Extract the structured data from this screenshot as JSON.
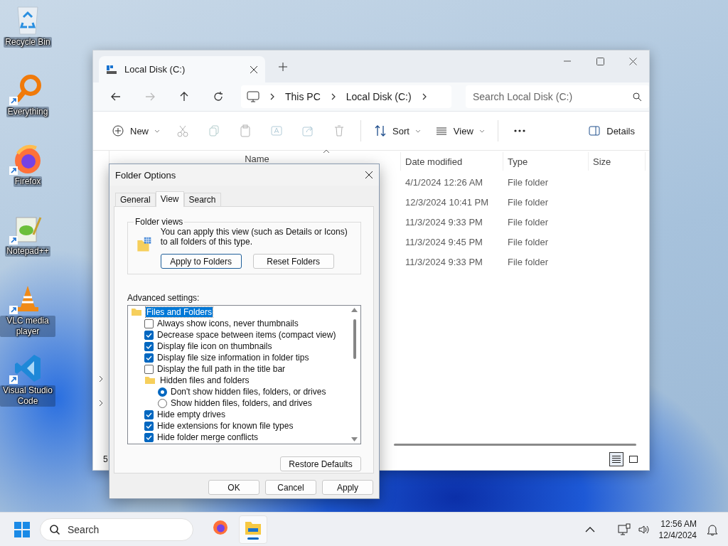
{
  "desktop_icons": [
    {
      "label": "Recycle Bin",
      "kind": "recycle",
      "shortcut": false
    },
    {
      "label": "Everything",
      "kind": "everything",
      "shortcut": true
    },
    {
      "label": "Firefox",
      "kind": "firefox",
      "shortcut": true
    },
    {
      "label": "Notepad++",
      "kind": "notepad",
      "shortcut": true
    },
    {
      "label": "VLC media player",
      "kind": "vlc",
      "shortcut": true
    },
    {
      "label": "Visual Studio Code",
      "kind": "vscode",
      "shortcut": true
    }
  ],
  "explorer": {
    "tabs": [
      {
        "label": "Local Disk (C:)",
        "selected": true
      }
    ],
    "nav": [
      {
        "kind": "back",
        "disabled": false
      },
      {
        "kind": "forward",
        "disabled": true
      },
      {
        "kind": "up",
        "disabled": false
      },
      {
        "kind": "refresh",
        "disabled": false
      }
    ],
    "breadcrumb": [
      "This PC",
      "Local Disk (C:)"
    ],
    "search": {
      "placeholder": "Search Local Disk (C:)"
    },
    "toolbar": [
      {
        "kind": "new",
        "label": "New",
        "disabled": false
      },
      {
        "kind": "cut",
        "disabled": true
      },
      {
        "kind": "copy",
        "disabled": true
      },
      {
        "kind": "paste",
        "disabled": true
      },
      {
        "kind": "rename",
        "disabled": true
      },
      {
        "kind": "share",
        "disabled": true
      },
      {
        "kind": "delete",
        "disabled": true
      },
      {
        "kind": "sort",
        "label": "Sort",
        "disabled": false
      },
      {
        "kind": "view",
        "label": "View",
        "disabled": false
      },
      {
        "kind": "more",
        "disabled": false
      },
      {
        "kind": "details",
        "label": "Details",
        "disabled": false
      }
    ],
    "columns": [
      "Name",
      "Date modified",
      "Type",
      "Size"
    ],
    "rows": [
      {
        "date_modified": "4/1/2024 12:26 AM",
        "type": "File folder"
      },
      {
        "date_modified": "12/3/2024 10:41 PM",
        "type": "File folder"
      },
      {
        "date_modified": "11/3/2024 9:33 PM",
        "type": "File folder"
      },
      {
        "date_modified": "11/3/2024 9:45 PM",
        "type": "File folder"
      },
      {
        "date_modified": "11/3/2024 9:33 PM",
        "type": "File folder"
      }
    ],
    "status": "5",
    "layouts": [
      {
        "kind": "details",
        "selected": true
      },
      {
        "kind": "tiles",
        "selected": false
      }
    ]
  },
  "dialog": {
    "title": "Folder Options",
    "tabs": [
      {
        "label": "General",
        "selected": false
      },
      {
        "label": "View",
        "selected": true
      },
      {
        "label": "Search",
        "selected": false
      }
    ],
    "folder_views": {
      "legend": "Folder views",
      "description": "You can apply this view (such as Details or Icons) to all folders of this type.",
      "buttons": [
        {
          "label": "Apply to Folders",
          "focused": true
        },
        {
          "label": "Reset Folders",
          "focused": false
        }
      ]
    },
    "advanced_label": "Advanced settings:",
    "tree": [
      {
        "kind": "folder",
        "label": "Files and Folders",
        "selected": true,
        "children": [
          {
            "kind": "checkbox",
            "label": "Always show icons, never thumbnails",
            "checked": false
          },
          {
            "kind": "checkbox",
            "label": "Decrease space between items (compact view)",
            "checked": true
          },
          {
            "kind": "checkbox",
            "label": "Display file icon on thumbnails",
            "checked": true
          },
          {
            "kind": "checkbox",
            "label": "Display file size information in folder tips",
            "checked": true
          },
          {
            "kind": "checkbox",
            "label": "Display the full path in the title bar",
            "checked": false
          },
          {
            "kind": "folder",
            "label": "Hidden files and folders",
            "selected": false,
            "children": [
              {
                "kind": "radio",
                "label": "Don't show hidden files, folders, or drives",
                "selected": true
              },
              {
                "kind": "radio",
                "label": "Show hidden files, folders, and drives",
                "selected": false
              }
            ]
          },
          {
            "kind": "checkbox",
            "label": "Hide empty drives",
            "checked": true
          },
          {
            "kind": "checkbox",
            "label": "Hide extensions for known file types",
            "checked": true
          },
          {
            "kind": "checkbox",
            "label": "Hide folder merge conflicts",
            "checked": true
          }
        ]
      }
    ],
    "restore": "Restore Defaults",
    "footer": [
      "OK",
      "Cancel",
      "Apply"
    ]
  },
  "taskbar": {
    "search": {
      "placeholder": "Search"
    },
    "apps": [
      {
        "kind": "firefox",
        "active": false
      },
      {
        "kind": "explorer",
        "active": true
      }
    ],
    "time": "12:56 AM",
    "date": "12/4/2024"
  }
}
